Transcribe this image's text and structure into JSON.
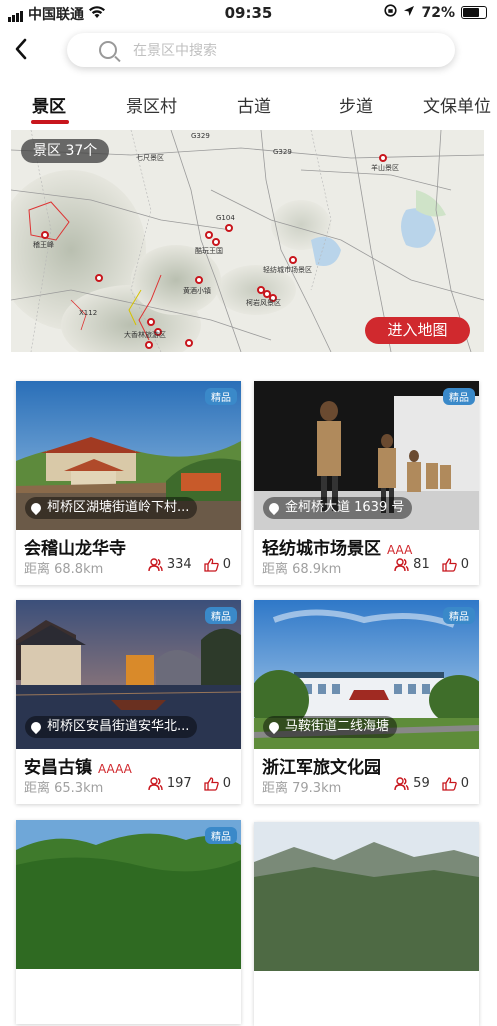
{
  "status": {
    "carrier": "中国联通",
    "time": "09:35",
    "battery": "72%"
  },
  "search": {
    "placeholder": "在景区中搜索"
  },
  "tabs": [
    {
      "label": "景区"
    },
    {
      "label": "景区村"
    },
    {
      "label": "古道"
    },
    {
      "label": "步道"
    },
    {
      "label": "文保单位"
    }
  ],
  "map": {
    "badge": "景区  37个",
    "button": "进入地图",
    "labels": [
      "G329",
      "G329",
      "羊山景区",
      "稽王峰",
      "G104",
      "酷玩王国",
      "黄酒小镇",
      "轻纺城市场景区",
      "柯岩风景区",
      "X112",
      "大香林旅游区",
      "七尺景区"
    ]
  },
  "cards": [
    {
      "tag": "精品",
      "location": "柯桥区湖塘街道岭下村...",
      "name": "会稽山龙华寺",
      "level": "",
      "distance": "距离 68.8km",
      "visitors": "334",
      "likes": "0"
    },
    {
      "tag": "精品",
      "location": "金柯桥大道 1639 号",
      "name": "轻纺城市场景区",
      "level": "AAA",
      "distance": "距离 68.9km",
      "visitors": "81",
      "likes": "0"
    },
    {
      "tag": "精品",
      "location": "柯桥区安昌街道安华北...",
      "name": "安昌古镇",
      "level": "AAAA",
      "distance": "距离 65.3km",
      "visitors": "197",
      "likes": "0"
    },
    {
      "tag": "精品",
      "location": "马鞍街道二线海塘",
      "name": "浙江军旅文化园",
      "level": "",
      "distance": "距离 79.3km",
      "visitors": "59",
      "likes": "0"
    },
    {
      "tag": "精品"
    }
  ],
  "colors": {
    "accent": "#c8161d",
    "tag": "#3a89c9"
  }
}
